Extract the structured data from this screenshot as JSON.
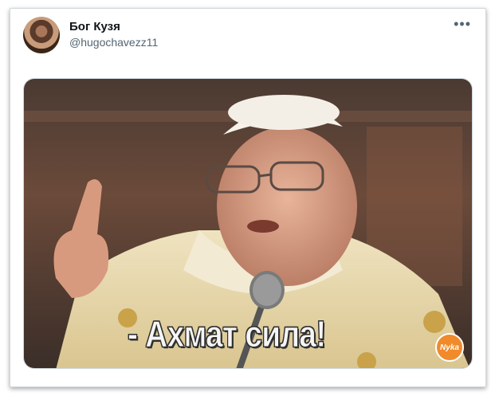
{
  "tweet": {
    "display_name": "Бог Кузя",
    "handle": "@hugochavezz11",
    "more_label": "•••",
    "media": {
      "caption": "- Ахмат сила!",
      "watermark": "Nyka"
    }
  }
}
